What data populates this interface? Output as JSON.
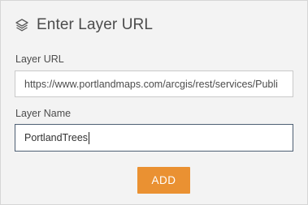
{
  "header": {
    "icon": "layers-icon",
    "title": "Enter Layer URL"
  },
  "form": {
    "url_label": "Layer URL",
    "url_value": "https://www.portlandmaps.com/arcgis/rest/services/Publi",
    "name_label": "Layer Name",
    "name_value": "PortlandTrees"
  },
  "actions": {
    "add_label": "ADD"
  },
  "colors": {
    "accent": "#ea9132",
    "panel_bg": "#f3f3f3",
    "focused_border": "#4e5f73"
  }
}
